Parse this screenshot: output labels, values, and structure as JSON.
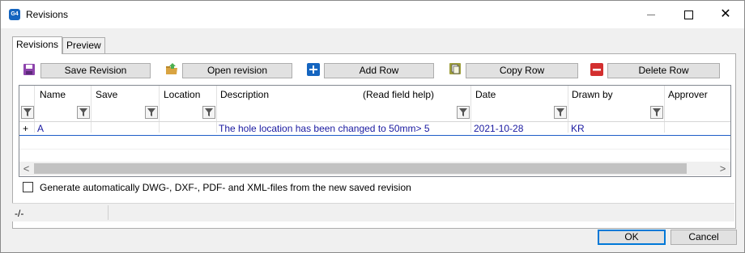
{
  "window": {
    "title": "Revisions",
    "app_icon_text": "G4"
  },
  "tabs": [
    {
      "label": "Revisions",
      "active": true
    },
    {
      "label": "Preview",
      "active": false
    }
  ],
  "toolbar": {
    "save_revision": "Save Revision",
    "open_revision": "Open revision",
    "add_row": "Add Row",
    "copy_row": "Copy Row",
    "delete_row": "Delete Row"
  },
  "grid": {
    "columns": [
      "Name",
      "Save",
      "Location",
      "Description",
      "(Read field help)",
      "Date",
      "Drawn by",
      "Approver"
    ],
    "rows": [
      {
        "marker": "+",
        "name": "A",
        "save": "",
        "location": "",
        "description": "The hole location has been changed to 50mm> 5",
        "date": "2021-10-28",
        "drawn_by": "KR",
        "approver": ""
      }
    ]
  },
  "scrollbar": {
    "left": "<",
    "right": ">"
  },
  "auto_generate": {
    "label": "Generate automatically DWG-, DXF-, PDF- and XML-files from the new saved revision",
    "checked": false
  },
  "status": {
    "text": "-/-"
  },
  "buttons": {
    "ok": "OK",
    "cancel": "Cancel"
  },
  "colors": {
    "accent": "#0078d7",
    "cell_text": "#1a1aa0",
    "row_border": "#1e5ec8"
  }
}
